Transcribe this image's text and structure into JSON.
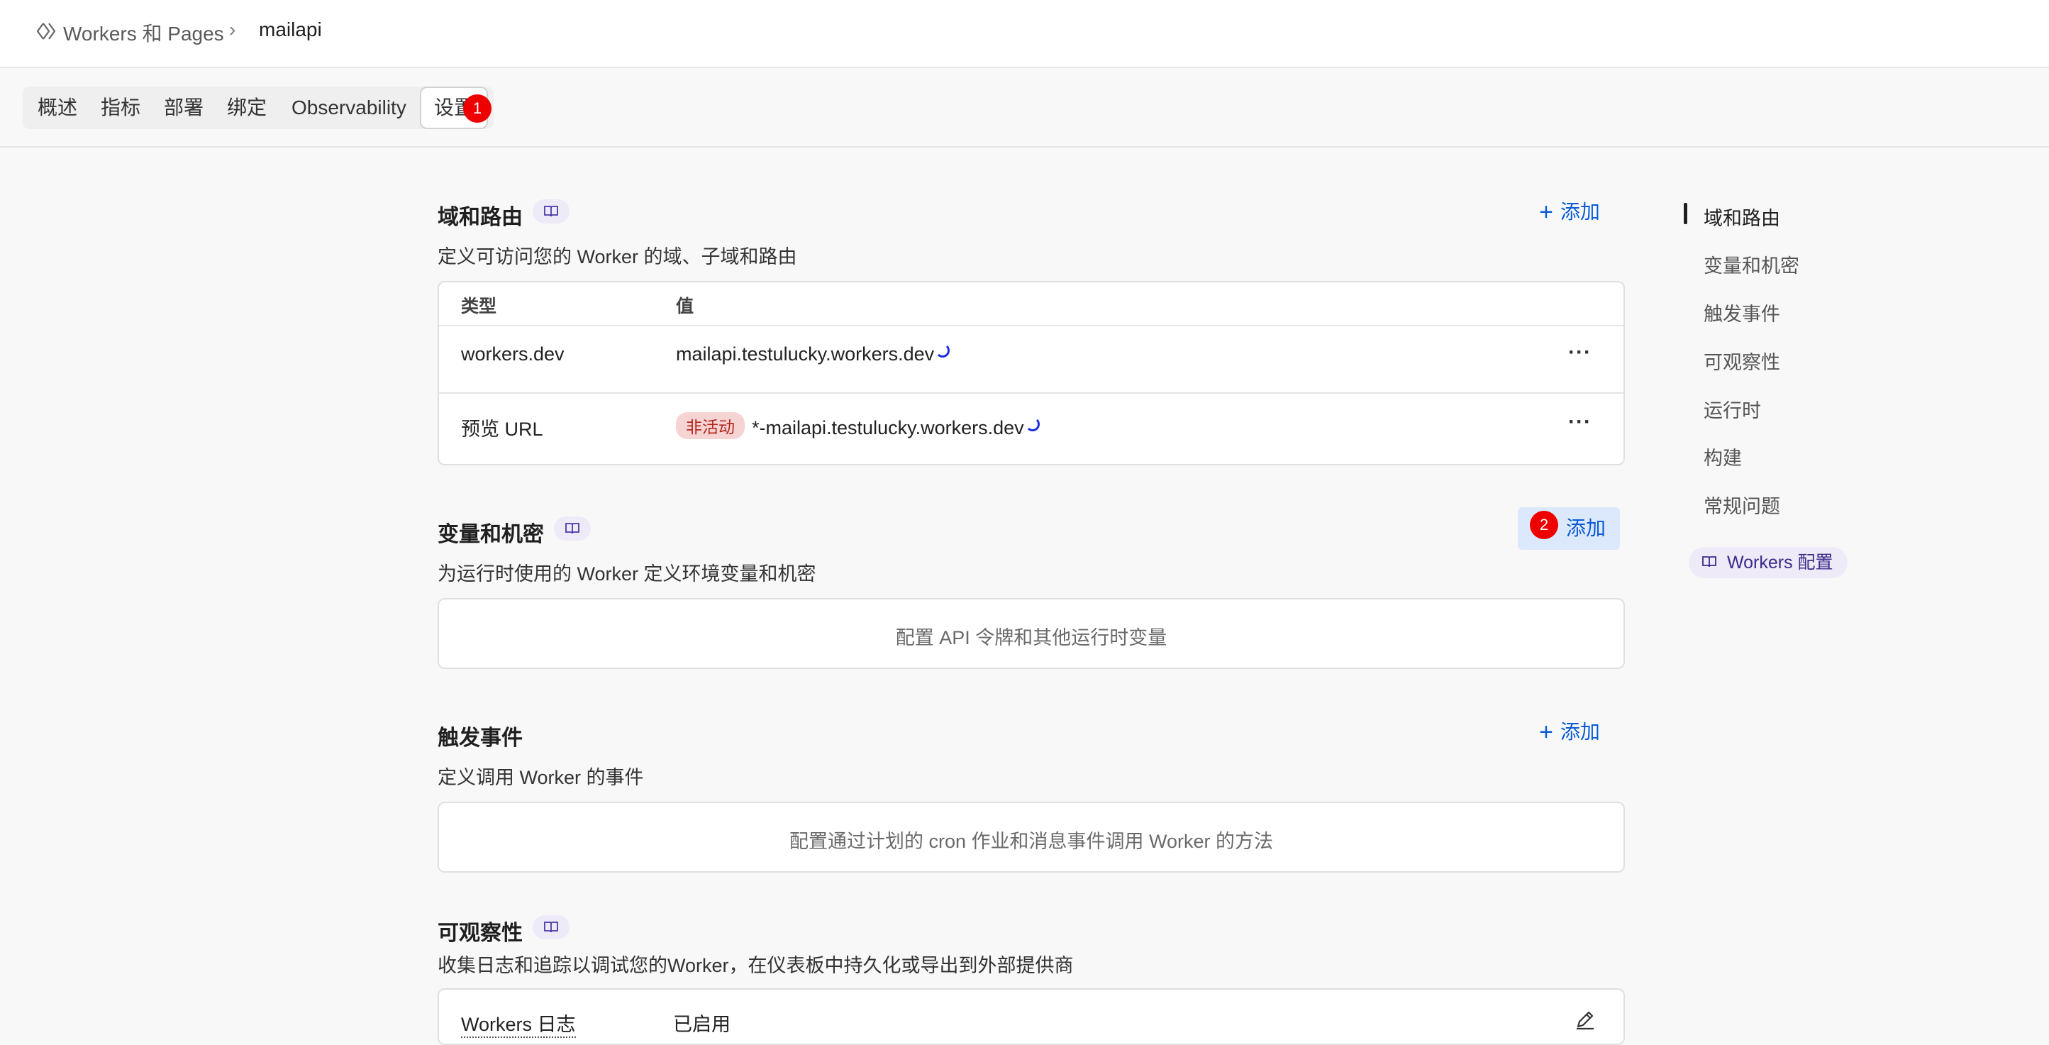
{
  "breadcrumb": {
    "root": "Workers 和 Pages",
    "separator": "›",
    "current": "mailapi"
  },
  "tabs": [
    {
      "label": "概述"
    },
    {
      "label": "指标"
    },
    {
      "label": "部署"
    },
    {
      "label": "绑定"
    },
    {
      "label": "Observability"
    },
    {
      "label": "设置"
    }
  ],
  "annotations": {
    "step1": "1",
    "step2": "2"
  },
  "sections": {
    "domains": {
      "title": "域和路由",
      "description": "定义可访问您的 Worker 的域、子域和路由",
      "add_label": "添加",
      "columns": [
        "类型",
        "值"
      ],
      "rows": [
        {
          "type": "workers.dev",
          "status": "",
          "value": "mailapi.testulucky.workers.dev"
        },
        {
          "type": "预览 URL",
          "status": "非活动",
          "value": "*-mailapi.testulucky.workers.dev"
        }
      ],
      "more_label": "···"
    },
    "variables": {
      "title": "变量和机密",
      "description": "为运行时使用的 Worker 定义环境变量和机密",
      "add_label": "添加",
      "empty_text": "配置 API 令牌和其他运行时变量"
    },
    "triggers": {
      "title": "触发事件",
      "description": "定义调用 Worker 的事件",
      "add_label": "添加",
      "empty_text": "配置通过计划的 cron 作业和消息事件调用 Worker 的方法"
    },
    "observability": {
      "title": "可观察性",
      "description": "收集日志和追踪以调试您的Worker，在仪表板中持久化或导出到外部提供商",
      "row_label": "Workers 日志",
      "row_value": "已启用"
    }
  },
  "toc": {
    "items": [
      "域和路由",
      "变量和机密",
      "触发事件",
      "可观察性",
      "运行时",
      "构建",
      "常规问题"
    ],
    "docs_link": "Workers 配置"
  },
  "colors": {
    "accent": "#0a5bd4",
    "badge": "#ee0000",
    "inactive_pill": "#f7d4d4"
  }
}
